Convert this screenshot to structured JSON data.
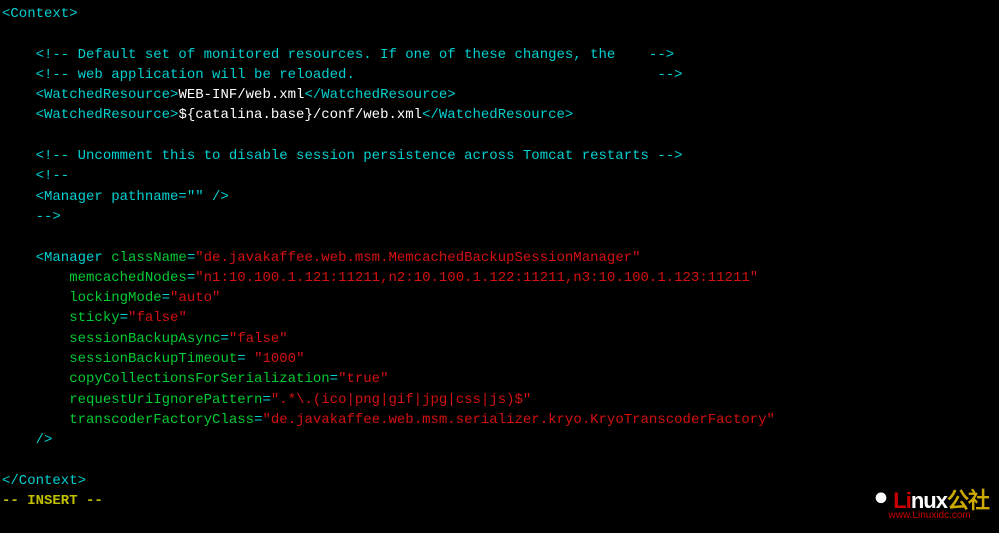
{
  "code": {
    "context_open": "<Context>",
    "comment_default": "    <!-- Default set of monitored resources. If one of these changes, the    -->",
    "comment_webapp": "    <!-- web application will be reloaded.                                    -->",
    "wr1_open": "    <WatchedResource>",
    "wr1_val": "WEB-INF/web.xml",
    "wr1_close": "</WatchedResource>",
    "wr2_open": "    <WatchedResource>",
    "wr2_val": "${catalina.base}/conf/web.xml",
    "wr2_close": "</WatchedResource>",
    "comment_uc1": "    <!-- Uncomment this to disable session persistence across Tomcat restarts -->",
    "comment_uc2": "    <!--",
    "comment_uc3": "    <Manager pathname=\"\" />",
    "comment_uc4": "    -->",
    "mgr_open": "    <Manager ",
    "attrs": {
      "className": {
        "k": "className",
        "eq": "=",
        "v": "\"de.javakaffee.web.msm.MemcachedBackupSessionManager\""
      },
      "memcachedNodes": {
        "pad": "        ",
        "k": "memcachedNodes",
        "eq": "=",
        "v": "\"n1:10.100.1.121:11211,n2:10.100.1.122:11211,n3:10.100.1.123:11211\""
      },
      "lockingMode": {
        "pad": "        ",
        "k": "lockingMode",
        "eq": "=",
        "v": "\"auto\""
      },
      "sticky": {
        "pad": "        ",
        "k": "sticky",
        "eq": "=",
        "v": "\"false\""
      },
      "sessionBackupAsync": {
        "pad": "        ",
        "k": "sessionBackupAsync",
        "eq": "=",
        "v": "\"false\""
      },
      "sessionBackupTimeout": {
        "pad": "        ",
        "k": "sessionBackupTimeout",
        "eq": "= ",
        "v": "\"1000\""
      },
      "copyCollectionsForSerialization": {
        "pad": "        ",
        "k": "copyCollectionsForSerialization",
        "eq": "=",
        "v": "\"true\""
      },
      "requestUriIgnorePattern": {
        "pad": "        ",
        "k": "requestUriIgnorePattern",
        "eq": "=",
        "v": "\".*\\.(ico|png|gif|jpg|css|js)$\""
      },
      "transcoderFactoryClass": {
        "pad": "        ",
        "k": "transcoderFactoryClass",
        "eq": "=",
        "v": "\"de.javakaffee.web.msm.serializer.kryo.KryoTranscoderFactory\""
      }
    },
    "mgr_close": "    />",
    "context_close": "</Context>",
    "mode": "-- INSERT --"
  },
  "logo": {
    "li": "Li",
    "nux": "nux",
    "gs": "公社",
    "url": "www.Linuxidc.com"
  }
}
